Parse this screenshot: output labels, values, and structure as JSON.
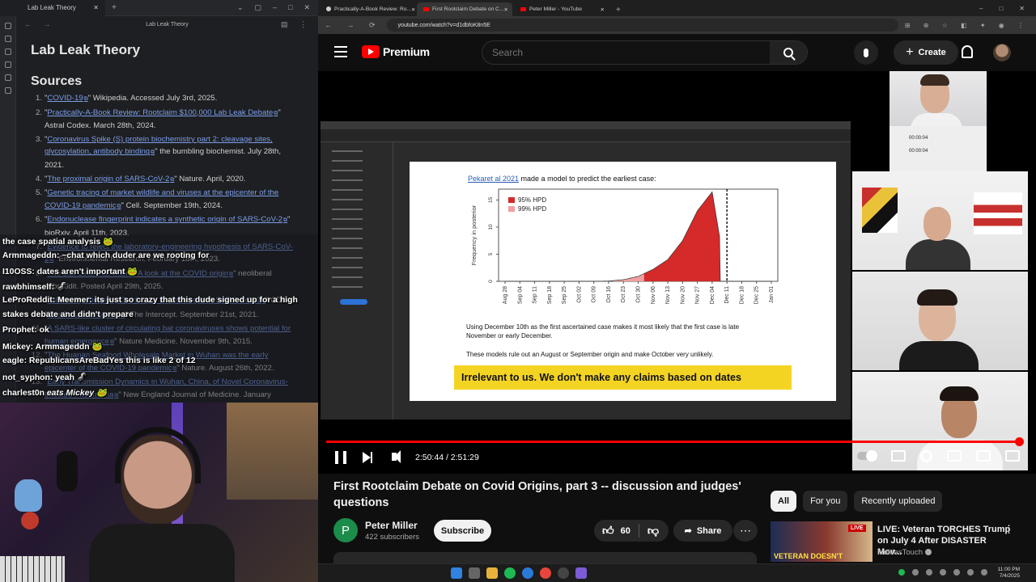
{
  "notes_app": {
    "tab_title": "Lab Leak Theory",
    "header_title": "Lab Leak Theory",
    "note_title": "Lab Leak Theory",
    "sources_heading": "Sources",
    "sources": [
      {
        "num": "1.",
        "pre": "\"",
        "link": "COVID-19",
        "post": "\" Wikipedia. Accessed July 3rd, 2025."
      },
      {
        "num": "2.",
        "pre": "\"",
        "link": "Practically-A-Book Review: Rootclaim $100,000 Lab Leak Debate",
        "post": "\" Astral Codex. March 28th, 2024."
      },
      {
        "num": "3.",
        "pre": "\"",
        "link": "Coronavirus Spike (S) protein biochemistry part 2: cleavage sites, glycosylation, antibody binding",
        "post": "\" the bumbling biochemist. July 28th, 2021."
      },
      {
        "num": "4.",
        "pre": "\"",
        "link": "The proximal origin of SARS-CoV-2",
        "post": "\" Nature. April, 2020."
      },
      {
        "num": "5.",
        "pre": "\"",
        "link": "Genetic tracing of market wildlife and viruses at the epicenter of the COVID-19 pandemic",
        "post": "\" Cell. September 19th, 2024."
      },
      {
        "num": "6.",
        "pre": "\"",
        "link": "Endonuclease fingerprint indicates a synthetic origin of SARS-CoV-2",
        "post": "\" bioRxiv. April 11th, 2023."
      },
      {
        "num": "7.",
        "pre": "\"",
        "link": "Evidence to reject the laboratory-engineering hypothesis of SARS-CoV-2",
        "post": "\" Environmental Research. February 18th, 2023."
      },
      {
        "num": "8.",
        "pre": "\"",
        "link": "The Lab Leak that wasn't: A look at the COVID origin",
        "post": "\" neoliberal subreddit. Posted April 29th, 2025."
      },
      {
        "num": "9.",
        "pre": "\"",
        "link": "Laboratory Biosafety Guidelines for working with SARS-CoV-2",
        "post": "\" CDC."
      },
      {
        "num": "10.",
        "pre": "\"",
        "link": "The Defuse Proposal",
        "post": "\" The Intercept. September 21st, 2021."
      },
      {
        "num": "11.",
        "pre": "\"",
        "link": "A SARS-like cluster of circulating bat coronaviruses shows potential for human emergence",
        "post": "\" Nature Medicine. November 9th, 2015."
      },
      {
        "num": "12.",
        "pre": "\"",
        "link": "The Huanan Seafood Wholesale Market in Wuhan was the early epicenter of the COVID-19 pandemic",
        "post": "\" Nature. August 26th, 2022."
      },
      {
        "num": "13.",
        "pre": "\"",
        "link": "Early Transmission Dynamics in Wuhan, China, of Novel Coronavirus-Infected Pneumonia",
        "post": "\" New England Journal of Medicine. January"
      }
    ]
  },
  "chat": [
    {
      "user": "",
      "text": "the case spatial analysis 🐸"
    },
    {
      "user": "Armmageddn:",
      "text": "~chat which duder are we rooting for"
    },
    {
      "user": "I10OSS:",
      "text": "dates aren't important 🐸"
    },
    {
      "user": "rawbhimself:",
      "text": "🦨"
    },
    {
      "user": "LeProReddit:",
      "text": "Meemer: its just so crazy that this dude signed up for a high"
    },
    {
      "user": "",
      "text": "stakes debate and didn't prepare"
    },
    {
      "user": "Prophet:",
      "text": "ok"
    },
    {
      "user": "Mickey:",
      "text": "Armmageddn 🐸"
    },
    {
      "user": "eagle:",
      "text": "RepublicansAreBadYes this is like 2 of 12"
    },
    {
      "user": "not_syphon:",
      "text": "yeah 🦨"
    },
    {
      "user": "charlest0n",
      "text": "eats Mickey 🐸"
    }
  ],
  "browser": {
    "tabs": [
      {
        "title": "Practically-A-Book Review: Ro...",
        "active": false
      },
      {
        "title": "First Rootclaim Debate on C...",
        "active": true
      },
      {
        "title": "Peter Miller - YouTube",
        "active": false
      }
    ],
    "url": "youtube.com/watch?v=d1dbfoK8n5E"
  },
  "youtube": {
    "brand": "Premium",
    "search_placeholder": "Search",
    "create_label": "Create",
    "slide": {
      "cite_link": "Pekaret al 2021",
      "cite_text": " made a model to predict the earliest case:",
      "para1": "Using December 10th as the first ascertained case makes it most likely that the first case is late November or early December.",
      "para2": "These models rule out an August or September origin and make October very unlikely.",
      "banner": "Irrelevant to us. We don't make any claims based on dates"
    },
    "panel_rows": [
      "00:00:04",
      "00:00:04"
    ],
    "time_display": "2:50:44 / 2:51:29",
    "progress": 0.996,
    "title": "First Rootclaim Debate on Covid Origins, part 3 -- discussion and judges' questions",
    "channel_name": "Peter Miller",
    "channel_initial": "P",
    "subscribers": "422 subscribers",
    "subscribe_label": "Subscribe",
    "likes": "60",
    "share_label": "Share",
    "chips": [
      "All",
      "For you",
      "Recently uploaded"
    ],
    "recommendation": {
      "live_badge": "LIVE",
      "thumb_caption": "VETERAN DOESN'T",
      "title": "LIVE: Veteran TORCHES Trump on July 4 After DISASTER Mov...",
      "channel": "MeidasTouch"
    }
  },
  "chart_data": {
    "type": "area",
    "ylabel": "Frequency in posterior",
    "y_ticks": [
      "0",
      "5",
      "10",
      "15"
    ],
    "ylim": [
      0,
      17
    ],
    "categories": [
      "Aug 28",
      "Sep 04",
      "Sep 11",
      "Sep 18",
      "Sep 25",
      "Oct 02",
      "Oct 09",
      "Oct 16",
      "Oct 23",
      "Oct 30",
      "Nov 06",
      "Nov 13",
      "Nov 20",
      "Nov 27",
      "Dec 04",
      "Dec 11",
      "Dec 18",
      "Dec 25",
      "Jan 01"
    ],
    "legend": [
      {
        "name": "95% HPD",
        "color": "#d42a2a"
      },
      {
        "name": "99% HPD",
        "color": "#f0a0a0"
      }
    ],
    "series": [
      {
        "name": "posterior",
        "values": [
          0,
          0,
          0,
          0,
          0,
          0,
          0,
          0.05,
          0.3,
          0.9,
          2.2,
          4.0,
          7.5,
          13.0,
          16.5,
          0,
          0,
          0,
          0
        ]
      }
    ],
    "hpd99_start_index": 7.3,
    "hpd95_start_index": 9.4,
    "marker_index": 15
  },
  "taskbar": {
    "time": "11:00 PM",
    "date": "7/4/2025"
  },
  "colors": {
    "yt_red": "#ff0000",
    "banner_yellow": "#f4d423",
    "link_blue": "#7b9ee8"
  }
}
